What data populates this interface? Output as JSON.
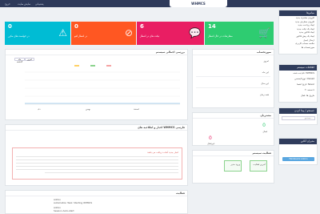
{
  "topbar": {
    "logo": "WHMCS",
    "items": [
      "خروج",
      "نمایش سایت",
      "پشتیبانی"
    ]
  },
  "header": {
    "title": "داشبورد پیشرفته"
  },
  "tiles": [
    {
      "num": "14",
      "label": "سفارشات در حال انتظار",
      "color": "#2ecc71",
      "icon": "cart-icon"
    },
    {
      "num": "6",
      "label": "تیکت های در انتظار",
      "color": "#e91e63",
      "icon": "chat-icon"
    },
    {
      "num": "0",
      "label": "در انتظار لغو",
      "color": "#ff5722",
      "icon": "block-icon"
    },
    {
      "num": "0",
      "label": "در خواست های مکرر",
      "color": "#00bcd4",
      "icon": "warning-icon"
    }
  ],
  "sidebar": {
    "shortcuts_title": "میانبرها",
    "shortcuts": [
      "افزودن مشتری جدید",
      "افزودن سفارش جدید",
      "ایجاد پرداخت جدید",
      "ایجاد یک تیکت جدید",
      "ایجاد فاکتور جدید",
      "ایجاد یک پیش فاکتور",
      "ارسال ایمیل",
      "خلاصه حساب کاربری",
      "صورتحساب ها"
    ],
    "system_title": "اطلاعات سیستم",
    "system": [
      "نام ثبت شده: WHMCS",
      "نوع لایسنس: Owned",
      "تاریخ انقضا: Never",
      "نسخه: 7.x",
      "ماژول ها: فعال"
    ],
    "search_title": "جستجو / پیدا کردن",
    "search_placeholder": "جستجو...",
    "admin_title": "مدیران آنلاین",
    "admin_button": "Fahdzoomi Admin"
  },
  "chart_panel": {
    "title": "بررسی اجمالی سیستم",
    "tabs": [
      "امروز",
      "ماه گذشته",
      "سال گذشته"
    ],
    "xlabels": [
      "دی",
      "بهمن",
      "اسفند"
    ]
  },
  "billing_panel": {
    "title": "صورتحساب",
    "rows": [
      "امروز",
      "این ماه",
      "این سال",
      "همه زمان"
    ]
  },
  "clients_panel": {
    "title": "مشتریان",
    "values": [
      "0",
      "0"
    ],
    "labels": [
      "فعال",
      "غیرفعال"
    ]
  },
  "activity_panel": {
    "title": "فعالیت سیستم",
    "items": [
      "آخرین فعالیت",
      "ورود مدیر"
    ]
  },
  "news_panel": {
    "title": "اخبار و اطلاعیه های WHMCS فارسی",
    "alert": "اخبار جدید آماده دریافت می باشد"
  },
  "tasks_panel": {
    "title": "فعالیت",
    "rows": [
      "Admin",
      "Automation Task: Starting WHMCS",
      "Admin",
      "Session Auto-start"
    ]
  }
}
